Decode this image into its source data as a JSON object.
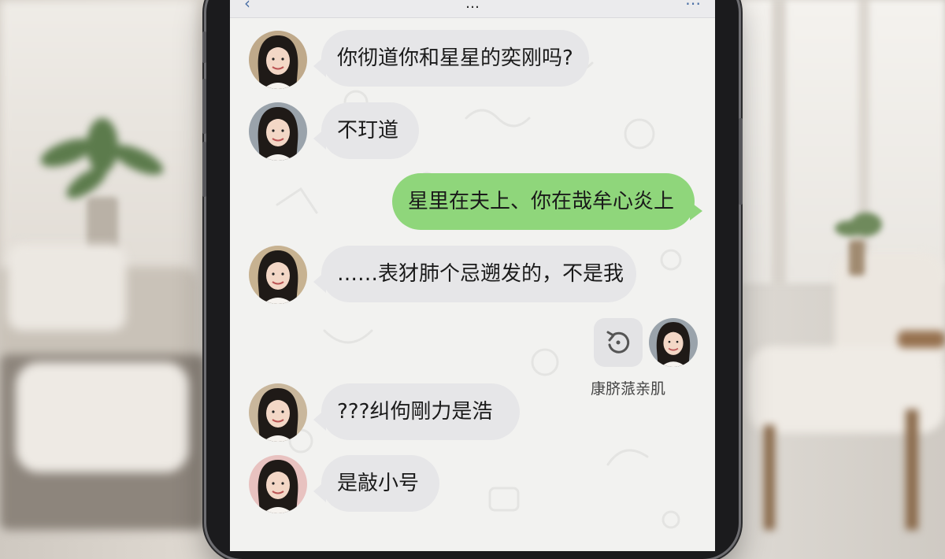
{
  "chat": {
    "header_title": "…",
    "messages": [
      {
        "side": "in",
        "text": "你彻道你和星星的奕刚吗?"
      },
      {
        "side": "in",
        "text": "不玎道"
      },
      {
        "side": "out",
        "text": "星里在夫上、你在哉牟心炎上"
      },
      {
        "side": "in",
        "text": "……表犲肺个忌遡发的，不是我"
      },
      {
        "side": "in",
        "text": "???纠佝剛力是浩"
      },
      {
        "side": "in",
        "text": "是敲小号"
      }
    ],
    "system_event": {
      "caption": "康脐蒎亲肌",
      "icon": "refresh-icon"
    }
  },
  "colors": {
    "incoming_bubble": "#e6e6e8",
    "outgoing_bubble": "#8fd67b",
    "chat_background": "#f2f2f0",
    "phone_frame": "#1b1b1d"
  }
}
